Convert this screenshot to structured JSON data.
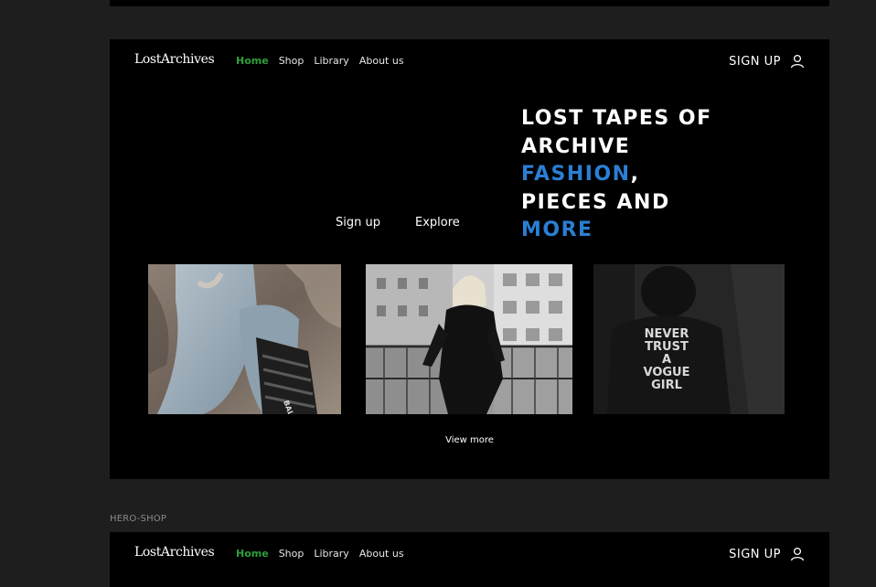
{
  "frames": {
    "hero": {
      "nav": {
        "logo": "LostArchives",
        "links": [
          "Home",
          "Shop",
          "Library",
          "About us"
        ],
        "signup": "SIGN UP"
      },
      "buttons": {
        "signup": "Sign up",
        "explore": "Explore"
      },
      "headline": {
        "line1": "LOST TAPES OF",
        "line2": "ARCHIVE",
        "accent1": "FASHION",
        "comma": ",",
        "line4": "PIECES AND",
        "accent2": "MORE"
      },
      "jacket_text": [
        "NEVER",
        "TRUST",
        "A",
        "VOGUE",
        "GIRL"
      ],
      "sole_text": "BALENC",
      "view_more": "View more"
    },
    "shop": {
      "label": "HERO-SHOP",
      "nav": {
        "logo": "LostArchives",
        "links": [
          "Home",
          "Shop",
          "Library",
          "About us"
        ],
        "signup": "SIGN UP"
      }
    }
  },
  "colors": {
    "background": "#1e1e1e",
    "frame": "#000000",
    "active_nav": "#2e9e3a",
    "accent": "#2a7fd4"
  },
  "icons": [
    "user-icon"
  ]
}
